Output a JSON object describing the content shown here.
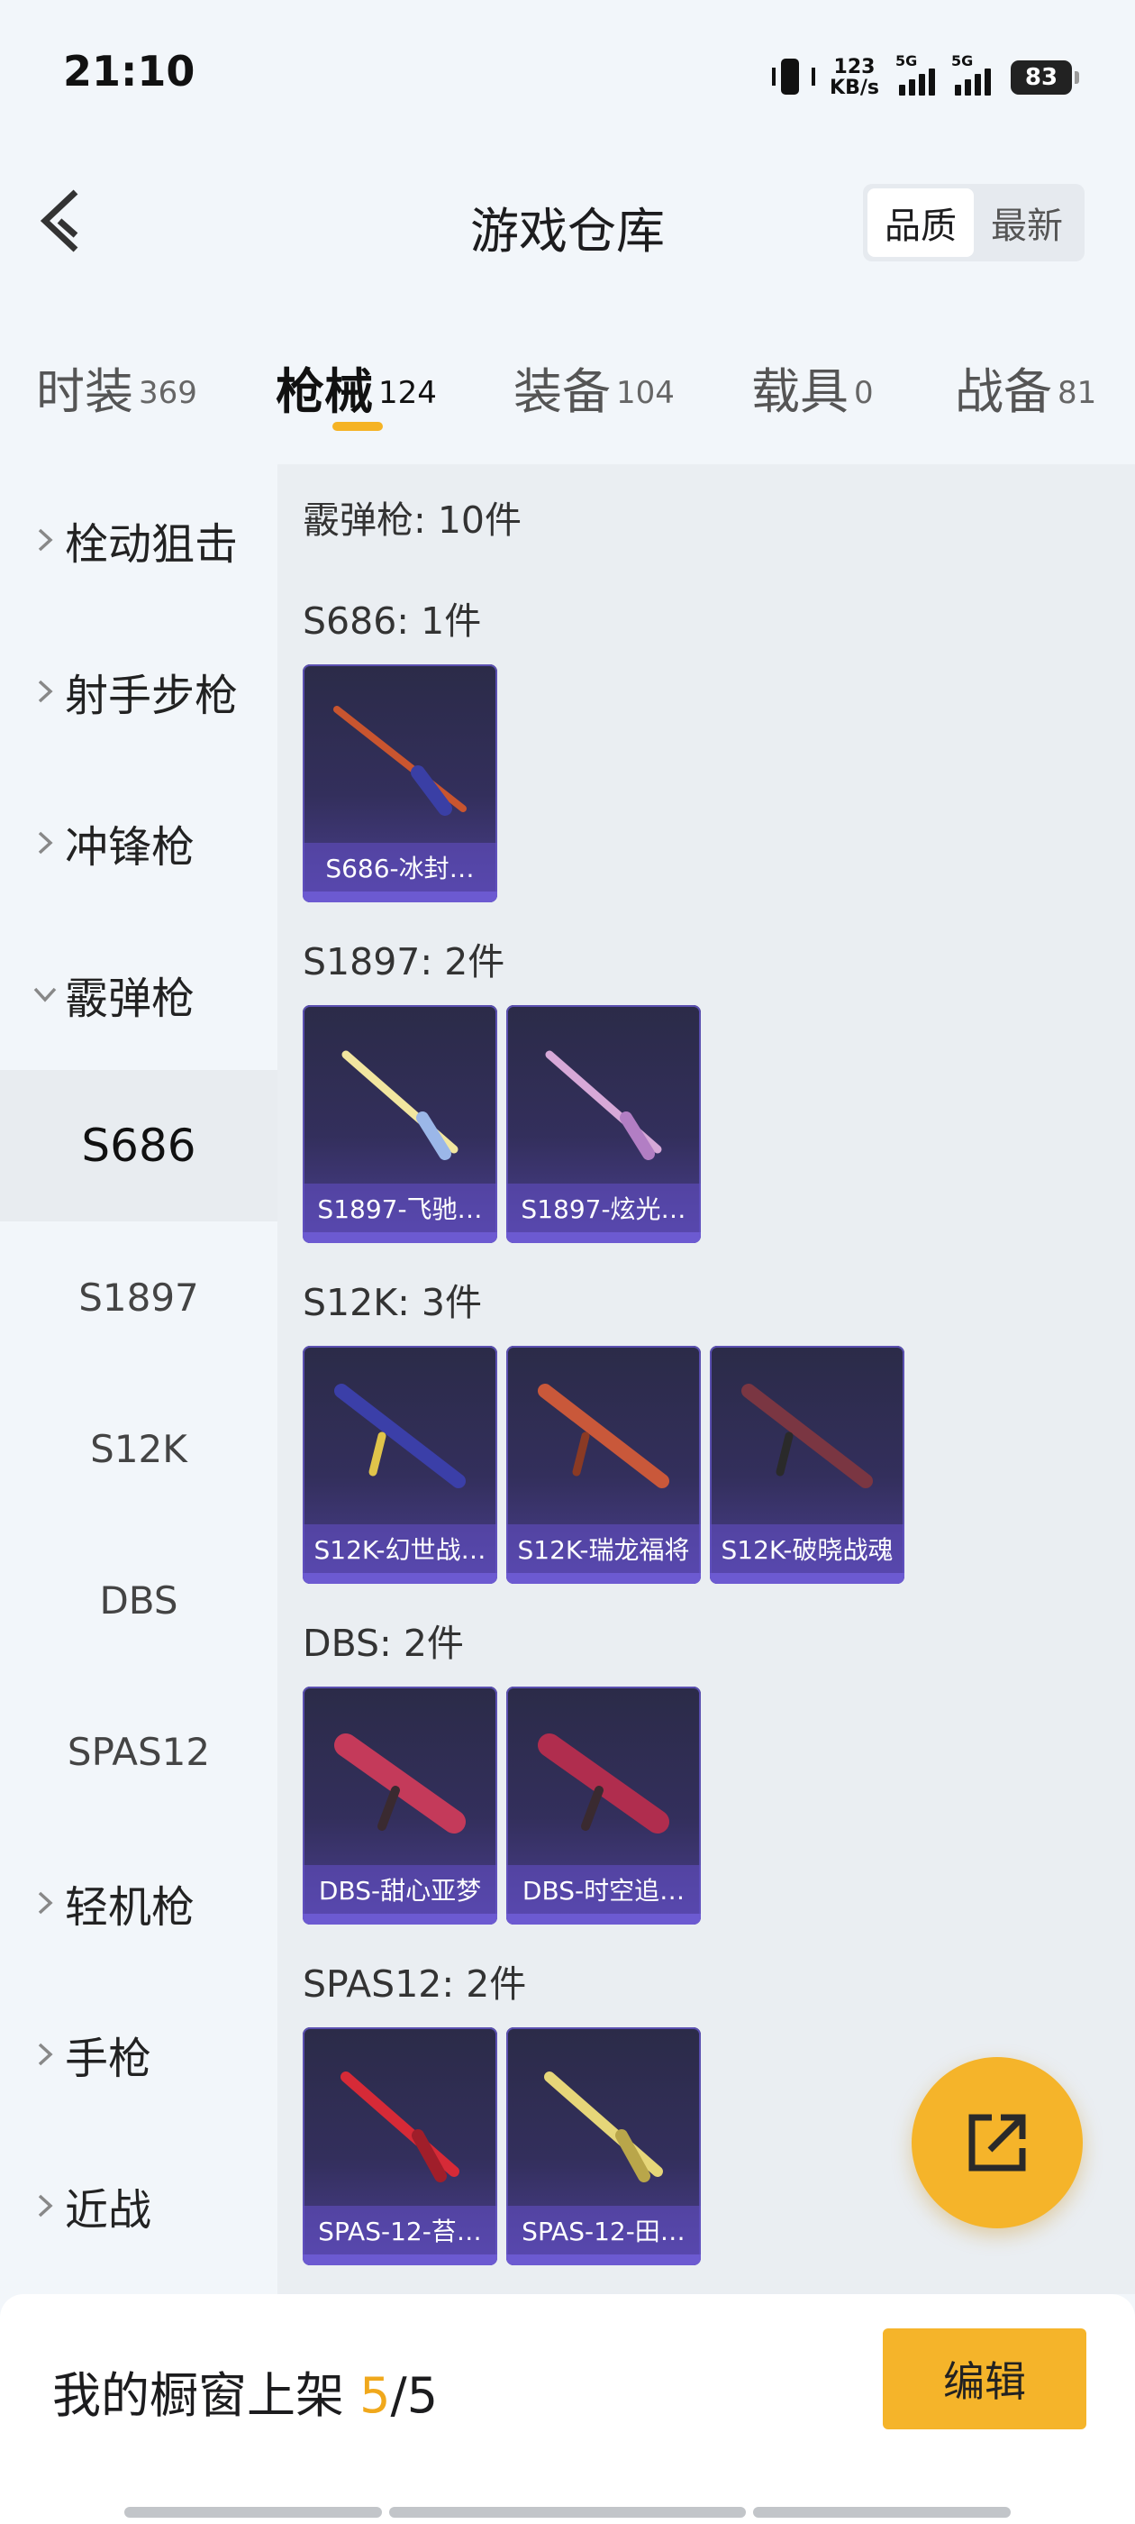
{
  "status_bar": {
    "time": "21:10",
    "net_speed_value": "123",
    "net_speed_unit": "KB/s",
    "signal_tag_1": "5G",
    "signal_tag_2": "5G",
    "battery": "83",
    "icons": [
      "vibrate-icon",
      "signal-icon",
      "signal-icon",
      "battery-icon"
    ]
  },
  "header": {
    "title": "游戏仓库",
    "sort_options": [
      "品质",
      "最新"
    ],
    "sort_active": "品质"
  },
  "tabs": [
    {
      "label": "时装",
      "count": "369"
    },
    {
      "label": "枪械",
      "count": "124",
      "active": true
    },
    {
      "label": "装备",
      "count": "104"
    },
    {
      "label": "载具",
      "count": "0"
    },
    {
      "label": "战备",
      "count": "81"
    }
  ],
  "sidebar": {
    "items": [
      {
        "label": "栓动狙击",
        "type": "category",
        "expanded": false
      },
      {
        "label": "射手步枪",
        "type": "category",
        "expanded": false
      },
      {
        "label": "冲锋枪",
        "type": "category",
        "expanded": false
      },
      {
        "label": "霰弹枪",
        "type": "category",
        "expanded": true
      },
      {
        "label": "S686",
        "type": "sub",
        "selected": true
      },
      {
        "label": "S1897",
        "type": "sub"
      },
      {
        "label": "S12K",
        "type": "sub"
      },
      {
        "label": "DBS",
        "type": "sub"
      },
      {
        "label": "SPAS12",
        "type": "sub"
      },
      {
        "label": "轻机枪",
        "type": "category",
        "expanded": false
      },
      {
        "label": "手枪",
        "type": "category",
        "expanded": false
      },
      {
        "label": "近战",
        "type": "category",
        "expanded": false
      }
    ]
  },
  "content": {
    "summary": "霰弹枪: 10件",
    "groups": [
      {
        "title": "S686: 1件",
        "items": [
          {
            "label": "S686-冰封…",
            "icon": "shotgun-icon",
            "color": "#c9552f"
          }
        ]
      },
      {
        "title": "S1897: 2件",
        "items": [
          {
            "label": "S1897-飞驰…",
            "icon": "shotgun-icon",
            "color": "#f2e6a0"
          },
          {
            "label": "S1897-炫光…",
            "icon": "shotgun-icon",
            "color": "#d7a9d8"
          }
        ]
      },
      {
        "title": "S12K: 3件",
        "items": [
          {
            "label": "S12K-幻世战…",
            "icon": "rifle-icon",
            "color": "#3b3fa8"
          },
          {
            "label": "S12K-瑞龙福将",
            "icon": "rifle-icon",
            "color": "#c9583a"
          },
          {
            "label": "S12K-破晓战魂",
            "icon": "rifle-icon",
            "color": "#7a3642"
          }
        ]
      },
      {
        "title": "DBS: 2件",
        "items": [
          {
            "label": "DBS-甜心亚梦",
            "icon": "bullpup-shotgun-icon",
            "color": "#c43a5a"
          },
          {
            "label": "DBS-时空追…",
            "icon": "bullpup-shotgun-icon",
            "color": "#b02d4e"
          }
        ]
      },
      {
        "title": "SPAS12: 2件",
        "items": [
          {
            "label": "SPAS-12-苔…",
            "icon": "shotgun-icon",
            "color": "#d62a37"
          },
          {
            "label": "SPAS-12-田…",
            "icon": "shotgun-icon",
            "color": "#e6d679"
          }
        ]
      }
    ]
  },
  "bottom": {
    "showcase_prefix": "我的橱窗上架 ",
    "showcase_count": "5",
    "showcase_total": "/5",
    "edit_label": "编辑"
  },
  "colors": {
    "accent": "#f5b42a",
    "tab_underline": "#f5b324",
    "card_bottom": "#6c5ad1"
  }
}
